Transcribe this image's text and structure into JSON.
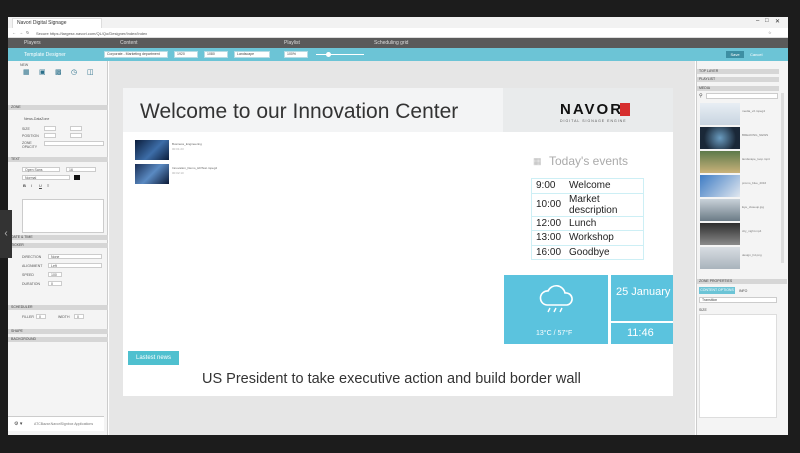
{
  "browser": {
    "tab_title": "Navori Digital Signage",
    "address": "Secure  https://largesx.navori.com/QL/Qo/Designer/Index/Index"
  },
  "app_tabs": [
    "Players",
    "Content",
    "Playlist",
    "Scheduling grid"
  ],
  "toolbar": {
    "title": "Template Designer",
    "selects": [
      "Corporate - Marketing department",
      "1920",
      "1080",
      "Landscape",
      "100%"
    ],
    "save_label": "Save",
    "cancel_label": "Cancel"
  },
  "left_panel": {
    "sections": {
      "new": "NEW",
      "zone": "ZONE",
      "text": "TEXT",
      "date_time": "DATE & TIME",
      "ticker": "TICKER",
      "scheduler": "SCHEDULER",
      "shape": "SHAPE",
      "background": "BACKGROUND"
    },
    "zone_name": "News-DataZone",
    "size_label": "SIZE",
    "position_label": "POSITION",
    "zone_opacity_label": "ZONE OPACITY",
    "font": "Open Sans",
    "font_size": "16",
    "font_weight": "Normal",
    "ticker_rows": [
      "DIRECTION",
      "ALIGNMENT",
      "SPEED",
      "DURATION"
    ],
    "ticker_vals": [
      "None",
      "Left",
      "100",
      "0"
    ],
    "scheduler_labels": [
      "FILLER",
      "WIDTH"
    ],
    "scheduler_vals": [
      "0",
      "0"
    ]
  },
  "stage": {
    "header_title": "Welcome to our Innovation Center",
    "logo_text": "NAVORI",
    "logo_tagline": "DIGITAL SIGNAGE ENGINE",
    "videos": [
      {
        "title": "Business_Engineering",
        "meta": "00:01:23"
      },
      {
        "title": "Innovation_Demo_HDTest.mpeg4",
        "meta": "00:02:10"
      }
    ],
    "events_title": "Today's events",
    "events": [
      {
        "time": "9:00",
        "name": "Welcome"
      },
      {
        "time": "10:00",
        "name": "Market description"
      },
      {
        "time": "12:00",
        "name": "Lunch"
      },
      {
        "time": "13:00",
        "name": "Workshop"
      },
      {
        "time": "16:00",
        "name": "Goodbye"
      }
    ],
    "weather_temp": "13°C / 57°F",
    "date": "25 January",
    "time": "11:46",
    "news_label": "Lastest news",
    "news_headline": "US President to take executive action and build border wall"
  },
  "right_panel": {
    "sections": [
      "TOP LAYER",
      "PLAYLIST",
      "MEDIA"
    ],
    "thumb_labels": [
      "media_v2.mpeg4",
      "BREAKING_NEWS",
      "landscape_loop.mp4",
      "promo_blue_2016",
      "Eye_closeup.jpg",
      "city_night.mp4",
      "design_hd.png",
      "clip_final.mp4"
    ],
    "properties_title": "ZONE PROPERTIES",
    "prop_tabs": [
      "CONTENT OPTIONS",
      "INFO"
    ],
    "transition": "Transition",
    "size_label": "SIZE"
  },
  "footer": {
    "settings_label": "⚙ ▾",
    "status": "ATCBazar.NavoriSignbox Applications"
  },
  "colors": {
    "accent": "#6cc4d6",
    "weather_bg": "#5bc3de",
    "logo_red": "#d62e2e"
  }
}
